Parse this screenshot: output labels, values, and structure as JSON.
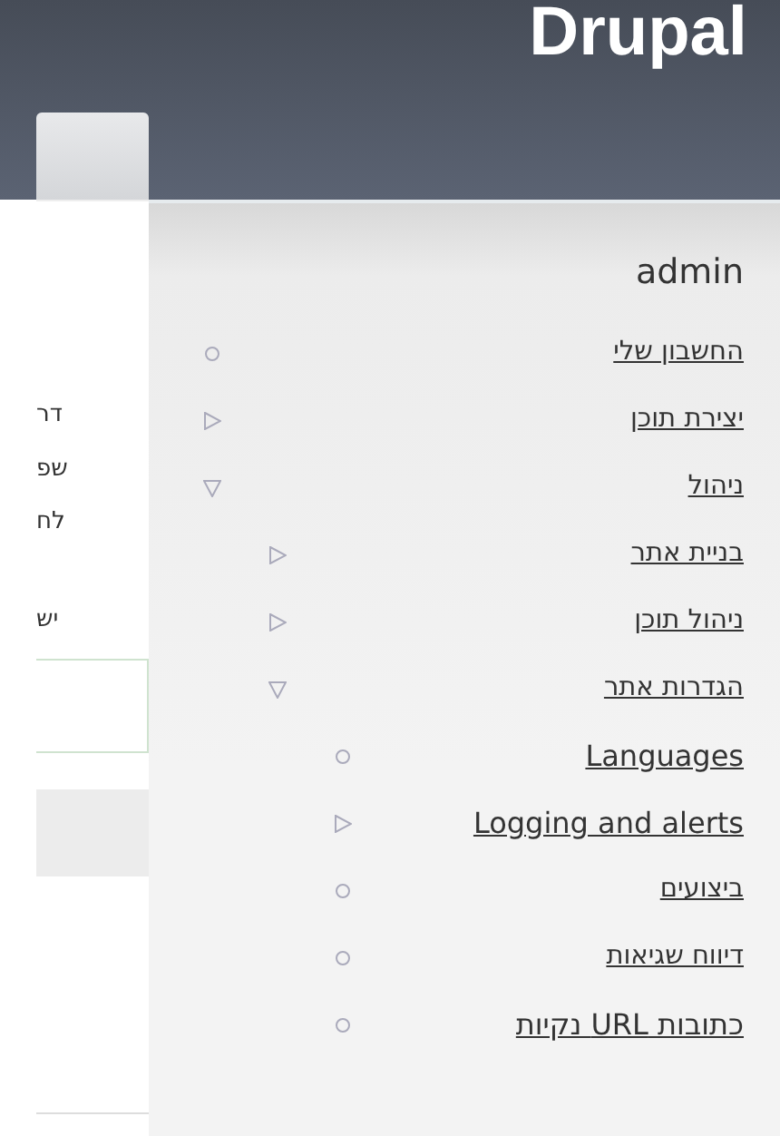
{
  "header": {
    "site_name": "Drupal"
  },
  "content": {
    "text_fragments": [
      "דר",
      "שפ",
      "לח",
      "יש"
    ]
  },
  "sidebar": {
    "title": "admin",
    "items": [
      {
        "label": "החשבון שלי",
        "kind": "leaf"
      },
      {
        "label": "יצירת תוכן",
        "kind": "branch",
        "expanded": false
      },
      {
        "label": "ניהול",
        "kind": "branch",
        "expanded": true,
        "children": [
          {
            "label": "בניית אתר",
            "kind": "branch",
            "expanded": false
          },
          {
            "label": "ניהול תוכן",
            "kind": "branch",
            "expanded": false
          },
          {
            "label": "הגדרות אתר",
            "kind": "branch",
            "expanded": true,
            "children": [
              {
                "label": "Languages",
                "kind": "leaf"
              },
              {
                "label": "Logging and alerts",
                "kind": "branch",
                "expanded": false
              },
              {
                "label": "ביצועים",
                "kind": "leaf"
              },
              {
                "label": "דיווח שגיאות",
                "kind": "leaf"
              },
              {
                "label": "כתובות URL נקיות",
                "kind": "leaf"
              }
            ]
          }
        ]
      }
    ]
  }
}
